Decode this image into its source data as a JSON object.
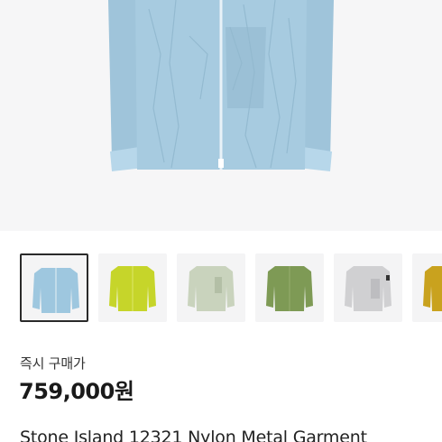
{
  "product": {
    "main_image": "blue-nylon-jacket-image",
    "thumbnails": [
      {
        "name": "blue-jacket-thumbnail",
        "color": "#9ec7df",
        "selected": true
      },
      {
        "name": "lime-jacket-thumbnail",
        "color": "#c6d52a",
        "selected": false
      },
      {
        "name": "sage-jacket-thumbnail",
        "color": "#c9d3bd",
        "selected": false
      },
      {
        "name": "olive-jacket-thumbnail",
        "color": "#7e9a55",
        "selected": false
      },
      {
        "name": "grey-jacket-thumbnail",
        "color": "#d0d0d2",
        "selected": false
      },
      {
        "name": "mustard-jacket-thumbnail",
        "color": "#c9a21e",
        "selected": false
      }
    ],
    "buy_now_label": "즉시 구매가",
    "price": "759,000원",
    "title": "Stone Island 12321 Nylon Metal Garment"
  }
}
